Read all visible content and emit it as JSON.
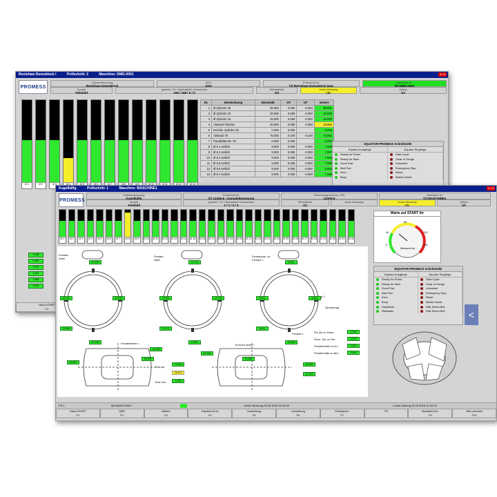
{
  "back": {
    "title_left": "Renishaw Demoblock I",
    "title_step": "Prüfschritt: 2",
    "title_machine": "Maschine: DMG-0001",
    "page_indicator": "1 / 2",
    "logo": "PROMESS",
    "header": [
      {
        "cap": "Teilebezeichnung",
        "val": "Renishaw Demoblock"
      },
      {
        "cap": "AVO",
        "val": "AVO"
      },
      {
        "cap": "Prüfschritt Nr.",
        "val": "[2] Renishaw Demoblock lang"
      },
      {
        "cap": "Maschine Nr.",
        "val": "[3] DMG-0001"
      },
      {
        "cap": "Anzahl",
        "val": "Teilebild"
      },
      {
        "cap": "gesamt / IO / Nacharbeit / Ausschuss",
        "val": "159 / 158 / 0 / 0"
      },
      {
        "cap": "Werkstücke",
        "val": "3/3"
      },
      {
        "cap": "letzte Messung",
        "val": "i.O."
      },
      {
        "cap": "Zyklus",
        "val": "1/1"
      }
    ],
    "bar_labels": [
      "M 1",
      "M 2",
      "M 3",
      "M 4",
      "M 5",
      "M 6",
      "M 7",
      "M 8",
      "M 9",
      "M 10",
      "M 11",
      "M 12",
      "M 13"
    ],
    "bar_values": [
      0.52,
      0.52,
      0.52,
      0.3,
      0.52,
      0.52,
      0.52,
      0.52,
      0.52,
      0.52,
      0.52,
      0.52,
      0.52
    ],
    "bar_yellow": [
      false,
      false,
      false,
      true,
      false,
      false,
      false,
      false,
      false,
      false,
      false,
      false,
      false
    ],
    "table_headers": [
      "Nr.",
      "Bezeichnung",
      "Nennmaß",
      "OT",
      "UT",
      "Istwert"
    ],
    "table_rows": [
      [
        "1",
        "Ø Zylinder 35",
        "35.000",
        "0.050",
        "-0.050",
        "35.001",
        "g"
      ],
      [
        "2",
        "Ø Zylinder 20",
        "20.000",
        "0.050",
        "-0.050",
        "20.000",
        "g"
      ],
      [
        "3",
        "Ø Zylinder 15",
        "15.000",
        "0.050",
        "-0.050",
        "15.000",
        "g"
      ],
      [
        "4",
        "Abstand Flächen",
        "20.000",
        "0.050",
        "-0.050",
        "19.962",
        "y"
      ],
      [
        "5",
        "Rechtw. Zylinder 35",
        "0.000",
        "0.050",
        "",
        "0.006",
        "g"
      ],
      [
        "6",
        "Abstand 75",
        "75.000",
        "0.100",
        "-0.100",
        "74.991",
        "g"
      ],
      [
        "7",
        "Parallelität Eb. 20",
        "0.000",
        "0.050",
        "",
        "0.000",
        "g"
      ],
      [
        "8",
        "Ø 8.1 seitlich",
        "8.000",
        "0.050",
        "-0.050",
        "7.998",
        "g"
      ],
      [
        "9",
        "Ø 8.2 seitlich",
        "8.000",
        "0.050",
        "-0.050",
        "7.997",
        "g"
      ],
      [
        "10",
        "Ø 8.4 seitlich",
        "8.000",
        "0.050",
        "-0.050",
        "7.999",
        "g"
      ],
      [
        "11",
        "Ø 8.5 seitlich",
        "8.000",
        "0.050",
        "-0.050",
        "7.998",
        "g"
      ],
      [
        "12",
        "Ø 8.6 seitlich",
        "8.000",
        "0.050",
        "-0.050",
        "8.000",
        "g"
      ],
      [
        "13",
        "Ø 8.7 seitlich",
        "8.000",
        "0.050",
        "-0.050",
        "7.999",
        "g"
      ]
    ],
    "panel_title": "EQUATOR-PROMESS Schnittstelle",
    "panel_out": "Equator Ausgänge",
    "panel_in": "Equator Eingänge",
    "outputs": [
      "Ready for Robot",
      "Ready for Start",
      "Good Part",
      "Bad Part",
      "Error",
      "Busy"
    ],
    "inputs": [
      "Start Cycle",
      "Clear of Gauge",
      "Unloaded",
      "Emergency Stop",
      "Reset",
      "Master-Mode"
    ],
    "left_values": [
      "4.996",
      "4.990",
      "4.991",
      "4.987",
      "3.980",
      "3.994"
    ],
    "hand_start": "Hand-START",
    "f1": "F1"
  },
  "front": {
    "title_left": "Kugelkäfig",
    "title_step": "Prüfschritt: 1",
    "title_machine": "Maschine: MASCHINE1",
    "page_indicator": "1 / 2",
    "logo": "PROMESS",
    "header": [
      {
        "cap": "Teilebezeichnung",
        "val": "Kugelkäfig"
      },
      {
        "cap": "Prüfschritt Nr.",
        "val": "[1] 12345-6 - Komplettmessung"
      },
      {
        "cap": "Zeichnungsnummer / PN",
        "val": "12345-6"
      },
      {
        "cap": "Maschine Nr.",
        "val": "[2] MASCHINE1"
      },
      {
        "cap": "Anzahl",
        "val": "Teilebild"
      },
      {
        "cap": "gesamt / IO / Nacharbeit / Ausschuss",
        "val": "1 / 1 / 0 / 0"
      },
      {
        "cap": "Werkstücke",
        "val": "1/1"
      },
      {
        "cap": "letzte Messung",
        "val": ""
      },
      {
        "cap": "letzte Messung",
        "val": "i.O."
      },
      {
        "cap": "Zyklus",
        "val": "1/1"
      }
    ],
    "bar_labels": [
      "M 1",
      "M 2",
      "M 3",
      "M 4",
      "M 5",
      "M 6",
      "M 7",
      "M 8",
      "M 9",
      "M 10",
      "M 11",
      "M 12",
      "M 13",
      "M 14",
      "M 15",
      "M 16",
      "M 17",
      "M 18",
      "M 19",
      "M 20",
      "M 21",
      "M 22",
      "M 23",
      "M 24",
      "M 25",
      "M 26",
      "M 27",
      "M 28",
      "M 29",
      "M 30",
      "M 31",
      "M 32"
    ],
    "bar_yellow_index": 7,
    "wait_title": "Warte auf START für",
    "gauge_center": "Messzeit ds",
    "gauge_ticks": [
      "0",
      "40",
      "80",
      "120",
      "160"
    ],
    "panel_title": "EQUATOR-PROMESS Schnittstelle",
    "panel_out": "Equator Ausgänge",
    "panel_in": "Equator Eingänge",
    "outputs": [
      "Ready for Robot",
      "Ready for Start",
      "Good Part",
      "Bad Part",
      "Error",
      "Busy",
      "Heartbeat",
      "ReMaster"
    ],
    "inputs": [
      "Start Cycle",
      "Clear of Gauge",
      "Unloaded",
      "Emergency Stop",
      "Reset",
      "Master-Mode",
      "DMI-Select Bit1",
      "DMI-Select Bit2"
    ],
    "labels": {
      "fensterhoehe": "Fenster-\nhöhe",
      "fenstermitte": "Fenster-\nmitte",
      "fensterpos": "Fensterpos. zu\nFenster 1",
      "steg": "Steg 1",
      "zimmerung": "Zimmerung",
      "fenster1": "Fenster 1",
      "fensterbreite": "Fensterbreite =",
      "dinnen": "Ø innen oben =",
      "dim_an": "Dim-An",
      "dim_ca": "Dim-Ca="
    },
    "ring_values": [
      [
        "19.700",
        "20.001",
        "20.000",
        "19.948",
        "19.700"
      ],
      [
        "19.702",
        "19.999",
        "19.703",
        "19.701",
        "19.801"
      ],
      [
        "8.810",
        "8.814",
        "8.812",
        "8.812",
        "19.900"
      ]
    ],
    "vals_right": [
      [
        "ISL din zu Dmin:",
        "0.099"
      ],
      [
        "Konz. Zyl. zu Dw:",
        "0.025"
      ],
      [
        "Fensterbreite zu K=",
        "0.616"
      ],
      [
        "Fenstermitte zu AK=",
        "0.616"
      ]
    ],
    "sec_vals_left": [
      "20.987",
      "18.269",
      "16.256"
    ],
    "sec_vals_mid": [
      "74.623",
      "74.677",
      "0.006"
    ],
    "sec_vals_right": [
      "18.350",
      "19.456",
      "52.900",
      "52.902"
    ],
    "status": {
      "ps": "PS 1",
      "ma": "MA MASCHINE1",
      "last": "Letzte Messung 09.05.2018 10:28:40",
      "null": "Letzte Nullung 09.05.2018 10:20:26"
    },
    "fkeys": [
      {
        "label": "Hand-START",
        "key": "F1"
      },
      {
        "label": "QRK",
        "key": "F2"
      },
      {
        "label": "Balken",
        "key": "F3"
      },
      {
        "label": "Equator-Error",
        "key": "F4"
      },
      {
        "label": "Umstellung",
        "key": "F5"
      },
      {
        "label": "Umstellung",
        "key": "F6"
      },
      {
        "label": "Prüfzyklus+",
        "key": "F7"
      },
      {
        "label": "",
        "key": "F8"
      },
      {
        "label": "Neustart-Korr.",
        "key": "F9"
      },
      {
        "label": "Wkz wechsel",
        "key": "F10"
      }
    ],
    "side_tab": "<"
  },
  "colors": {
    "title": "#0a1e8c",
    "green": "#2fe82f",
    "yellow": "#f5ee2a",
    "led_green": "#1fc91f",
    "led_red": "#8a1414"
  }
}
